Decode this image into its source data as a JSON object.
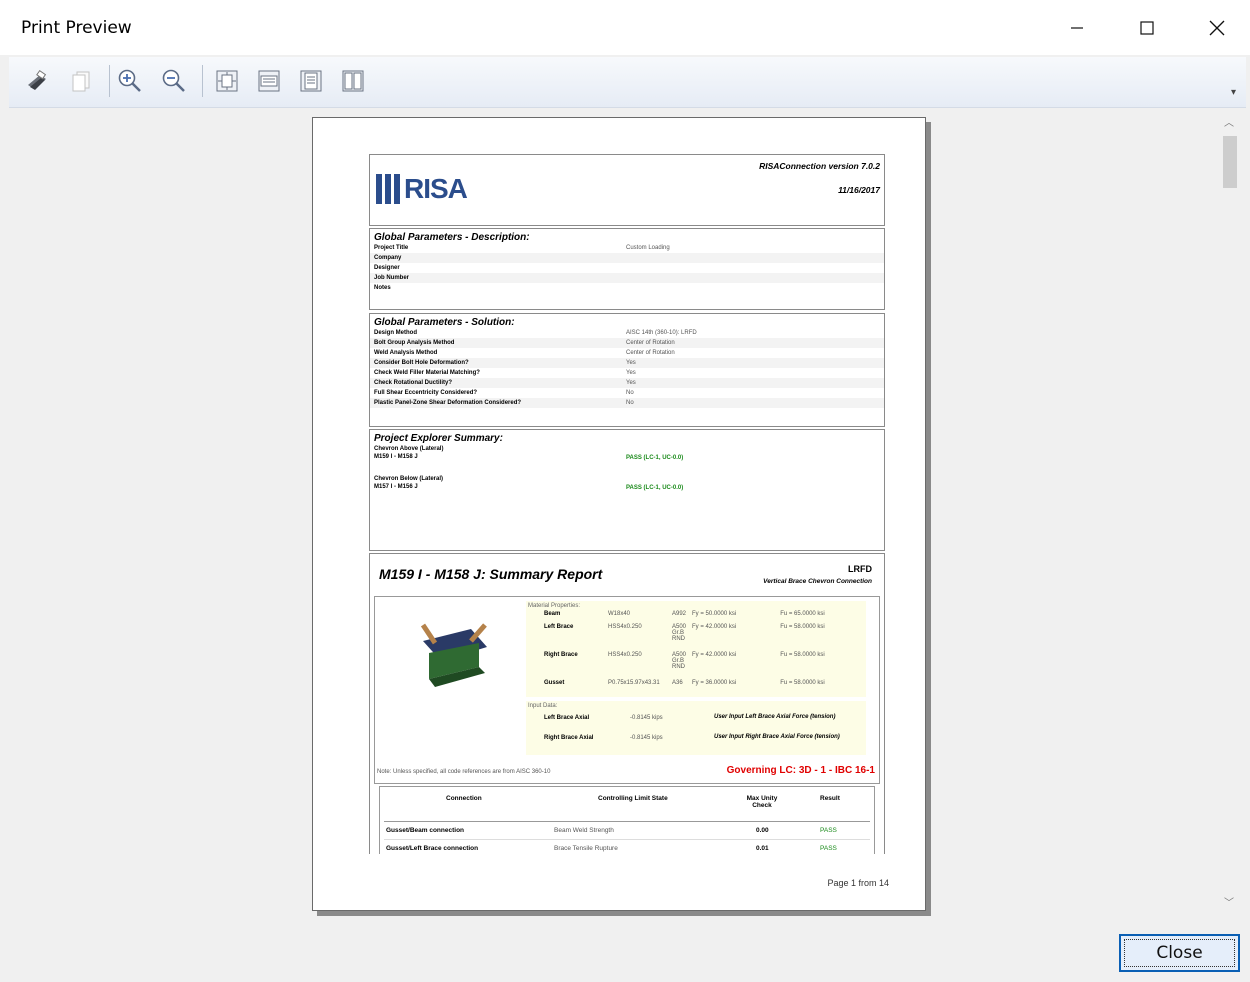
{
  "window": {
    "title": "Print Preview"
  },
  "toolbar": {
    "buttons": [
      {
        "icon": "print-icon"
      },
      {
        "icon": "copy-icon"
      },
      {
        "icon": "zoom-in-icon"
      },
      {
        "icon": "zoom-out-icon"
      },
      {
        "icon": "fit-page-icon"
      },
      {
        "icon": "fit-width-icon"
      },
      {
        "icon": "single-page-icon"
      },
      {
        "icon": "two-page-icon"
      }
    ]
  },
  "report": {
    "logo": "RISA",
    "version": "RISAConnection version 7.0.2",
    "date": "11/16/2017",
    "desc": {
      "heading": "Global Parameters - Description:",
      "rows": [
        {
          "label": "Project Title",
          "value": "Custom Loading"
        },
        {
          "label": "Company",
          "value": ""
        },
        {
          "label": "Designer",
          "value": ""
        },
        {
          "label": "Job Number",
          "value": ""
        },
        {
          "label": "Notes",
          "value": ""
        }
      ]
    },
    "solution": {
      "heading": "Global Parameters - Solution:",
      "rows": [
        {
          "label": "Design Method",
          "value": "AISC 14th (360-10): LRFD"
        },
        {
          "label": "Bolt Group Analysis Method",
          "value": "Center of Rotation"
        },
        {
          "label": "Weld Analysis Method",
          "value": "Center of Rotation"
        },
        {
          "label": "Consider Bolt Hole Deformation?",
          "value": "Yes"
        },
        {
          "label": "Check Weld Filler Material Matching?",
          "value": "Yes"
        },
        {
          "label": "Check Rotational Ductility?",
          "value": "Yes"
        },
        {
          "label": "Full Shear Eccentricity Considered?",
          "value": "No"
        },
        {
          "label": "Plastic Panel-Zone Shear Deformation Considered?",
          "value": "No"
        }
      ]
    },
    "explorer": {
      "heading": "Project Explorer Summary:",
      "groups": [
        {
          "name": "Chevron Above (Lateral)",
          "member": "M159 I - M158 J",
          "result": "PASS (LC-1, UC-0.0)"
        },
        {
          "name": "Chevron Below (Lateral)",
          "member": "M157 I - M156 J",
          "result": "PASS (LC-1, UC-0.0)"
        }
      ]
    },
    "summary": {
      "title": "M159 I - M158 J: Summary Report",
      "method": "LRFD",
      "type": "Vertical Brace Chevron Connection",
      "mat_heading": "Material Properties:",
      "materials": [
        {
          "name": "Beam",
          "shape": "W18x40",
          "grade": "A992",
          "fy": "Fy = 50.0000 ksi",
          "fu": "Fu = 65.0000 ksi"
        },
        {
          "name": "Left Brace",
          "shape": "HSS4x0.250",
          "grade": "A500 Gr.B RND",
          "fy": "Fy = 42.0000 ksi",
          "fu": "Fu = 58.0000 ksi"
        },
        {
          "name": "Right Brace",
          "shape": "HSS4x0.250",
          "grade": "A500 Gr.B RND",
          "fy": "Fy = 42.0000 ksi",
          "fu": "Fu = 58.0000 ksi"
        },
        {
          "name": "Gusset",
          "shape": "P0.75x15.97x43.31",
          "grade": "A36",
          "fy": "Fy = 36.0000 ksi",
          "fu": "Fu = 58.0000 ksi"
        }
      ],
      "input_heading": "Input Data:",
      "inputs": [
        {
          "name": "Left Brace Axial",
          "value": "-0.8145 kips",
          "note": "User Input Left Brace Axial Force (tension)"
        },
        {
          "name": "Right Brace Axial",
          "value": "-0.8145 kips",
          "note": "User Input Right Brace Axial Force (tension)"
        }
      ],
      "note": "Note: Unless specified, all code references are from AISC 360-10",
      "governing": "Governing LC: 3D - 1 - IBC 16-1",
      "table": {
        "headers": [
          "Connection",
          "Controlling Limit State",
          "Max Unity Check",
          "Result"
        ],
        "rows": [
          {
            "conn": "Gusset/Beam connection",
            "state": "Beam Weld Strength",
            "uc": "0.00",
            "result": "PASS"
          },
          {
            "conn": "Gusset/Left Brace connection",
            "state": "Brace Tensile Rupture",
            "uc": "0.01",
            "result": "PASS"
          }
        ]
      },
      "colors": {
        "pass": "#1a8a1a",
        "governing": "#e00000",
        "logo": "#2b4d8c"
      }
    },
    "page_label": "Page 1 from 14"
  },
  "close_label": "Close"
}
